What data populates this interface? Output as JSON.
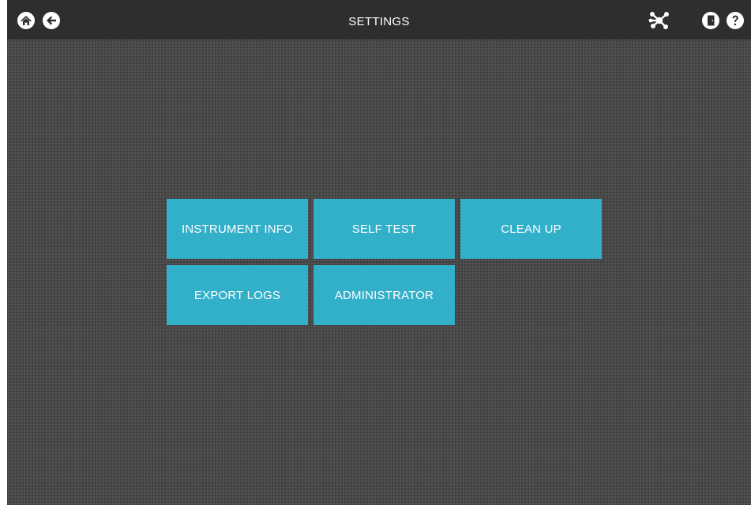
{
  "header": {
    "title": "SETTINGS",
    "icons": {
      "home": "home-icon",
      "back": "back-arrow-icon",
      "network": "network-icon",
      "exit": "exit-door-icon",
      "help": "help-icon"
    }
  },
  "menu": {
    "instrument_info": "INSTRUMENT INFO",
    "self_test": "SELF TEST",
    "clean_up": "CLEAN UP",
    "export_logs": "EXPORT LOGS",
    "administrator": "ADMINISTRATOR"
  },
  "colors": {
    "tile": "#32afc9",
    "topbar": "#2e2e2e",
    "background": "#4a4a4a",
    "text": "#ffffff"
  }
}
